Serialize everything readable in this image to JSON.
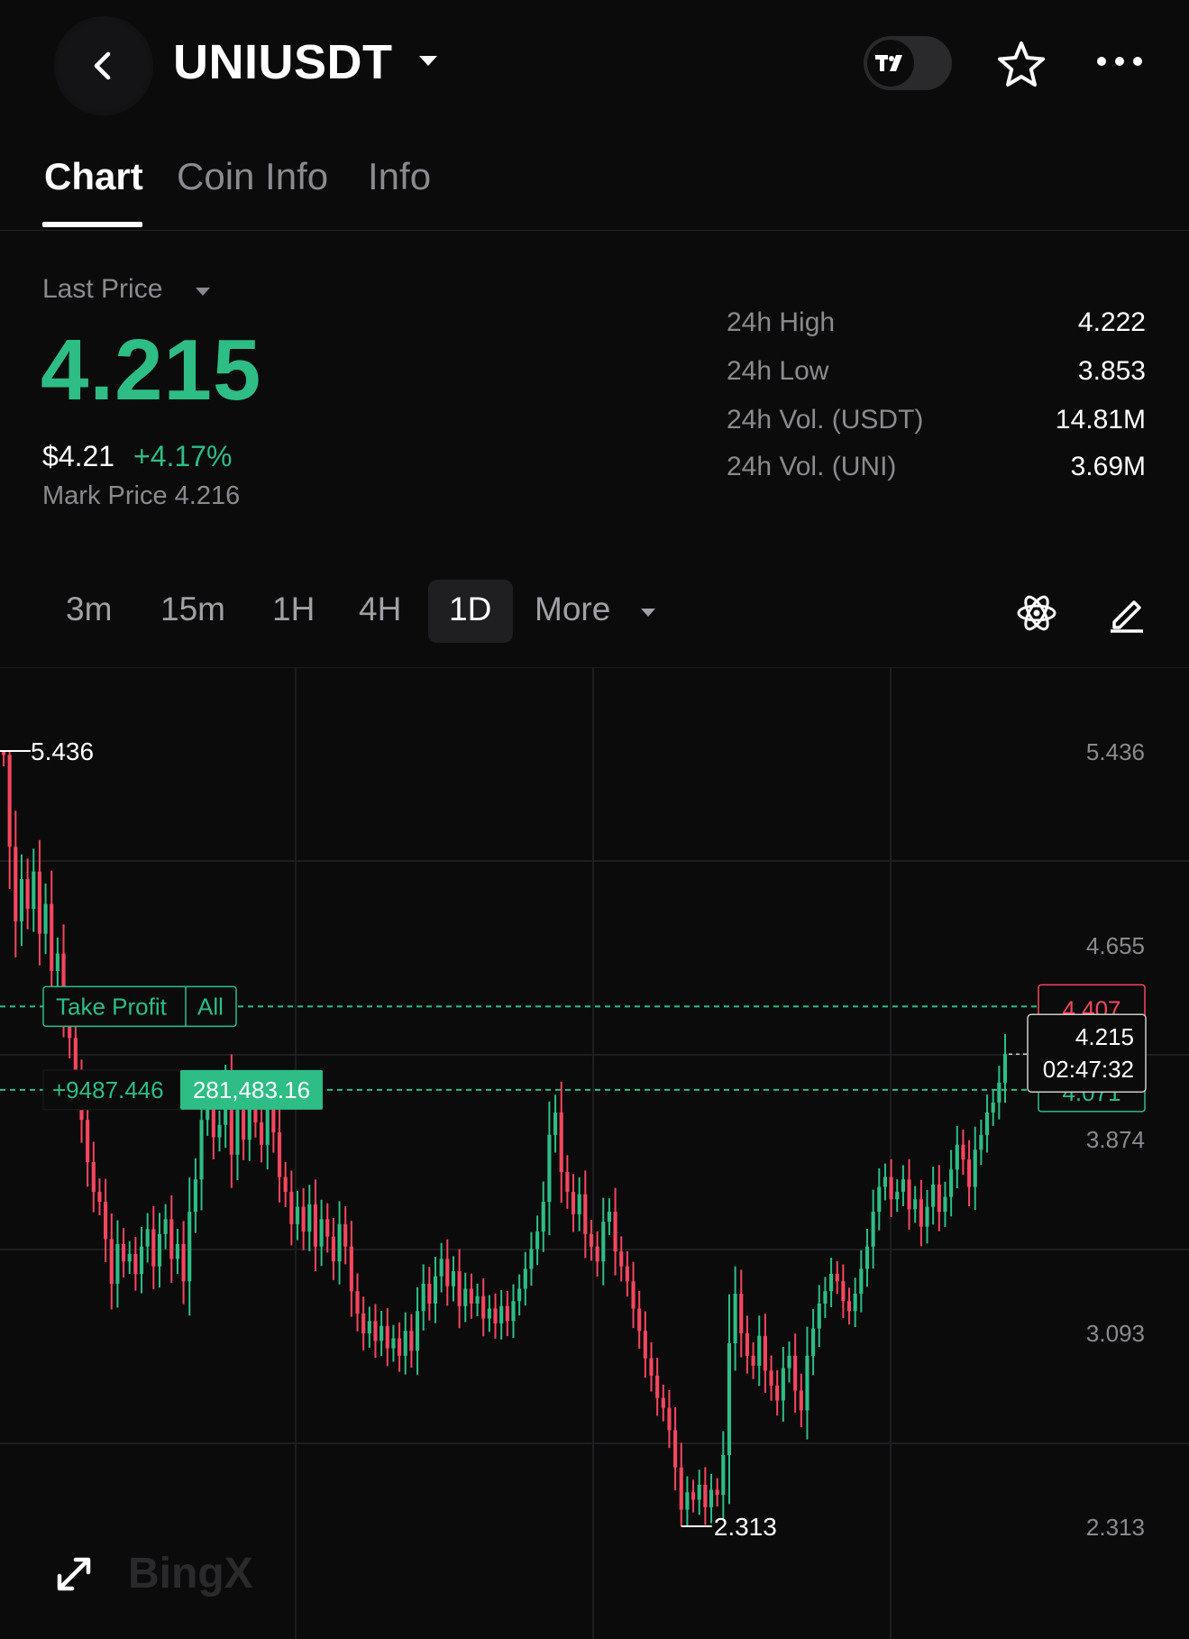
{
  "header": {
    "symbol": "UNIUSDT",
    "toggle_icon": "tradingview-logo-icon"
  },
  "tabs": [
    {
      "label": "Chart",
      "active": true
    },
    {
      "label": "Coin Info",
      "active": false
    },
    {
      "label": "Info",
      "active": false
    }
  ],
  "price": {
    "label": "Last Price",
    "last": "4.215",
    "usd": "$4.21",
    "change": "+4.17%",
    "mark": "Mark Price 4.216",
    "color_up": "#2ebd85"
  },
  "stats": [
    {
      "label": "24h High",
      "value": "4.222"
    },
    {
      "label": "24h Low",
      "value": "3.853"
    },
    {
      "label": "24h Vol. (USDT)",
      "value": "14.81M"
    },
    {
      "label": "24h Vol. (UNI)",
      "value": "3.69M"
    }
  ],
  "intervals": {
    "items": [
      "3m",
      "15m",
      "1H",
      "4H",
      "1D"
    ],
    "selected": "1D",
    "more_label": "More"
  },
  "chart_data": {
    "type": "candlestick",
    "y_ticks": [
      "5.436",
      "4.655",
      "3.874",
      "3.093",
      "2.313"
    ],
    "ylim": [
      2.313,
      5.436
    ],
    "high_marker": "5.436",
    "low_marker": "2.313",
    "take_profit": {
      "label": "Take Profit",
      "scope": "All",
      "price": "4.407"
    },
    "position": {
      "pnl": "+9487.446",
      "size": "281,483.16",
      "price": "4.071"
    },
    "current": {
      "price": "4.215",
      "countdown": "02:47:32"
    },
    "watermark": "BingX",
    "colors": {
      "up": "#2ebd85",
      "down": "#f6465d"
    },
    "closes": [
      5.42,
      5.05,
      4.75,
      4.92,
      4.8,
      4.95,
      4.7,
      4.82,
      4.55,
      4.62,
      4.4,
      4.28,
      4.1,
      3.95,
      3.78,
      3.66,
      3.62,
      3.47,
      3.29,
      3.45,
      3.38,
      3.41,
      3.33,
      3.44,
      3.51,
      3.36,
      3.49,
      3.55,
      3.39,
      3.45,
      3.3,
      3.58,
      3.71,
      3.95,
      4.02,
      3.88,
      3.93,
      4.08,
      3.81,
      3.99,
      3.87,
      4.0,
      3.94,
      3.85,
      4.02,
      3.9,
      3.72,
      3.66,
      3.53,
      3.6,
      3.5,
      3.61,
      3.44,
      3.55,
      3.48,
      3.38,
      3.53,
      3.44,
      3.26,
      3.17,
      3.09,
      3.14,
      3.06,
      3.12,
      3.03,
      3.07,
      3.0,
      3.1,
      3.02,
      3.18,
      3.29,
      3.21,
      3.32,
      3.39,
      3.28,
      3.34,
      3.2,
      3.27,
      3.21,
      3.24,
      3.15,
      3.19,
      3.13,
      3.2,
      3.14,
      3.22,
      3.27,
      3.35,
      3.43,
      3.5,
      3.62,
      3.89,
      3.98,
      3.74,
      3.66,
      3.57,
      3.65,
      3.49,
      3.44,
      3.38,
      3.54,
      3.58,
      3.42,
      3.36,
      3.3,
      3.19,
      3.1,
      2.99,
      2.92,
      2.83,
      2.79,
      2.7,
      2.55,
      2.38,
      2.45,
      2.42,
      2.48,
      2.39,
      2.46,
      2.44,
      2.6,
      3.05,
      3.25,
      3.09,
      3.0,
      2.96,
      3.08,
      2.94,
      2.88,
      2.82,
      2.95,
      3.0,
      2.86,
      2.78,
      3.0,
      3.11,
      3.21,
      3.26,
      3.33,
      3.3,
      3.22,
      3.18,
      3.25,
      3.35,
      3.44,
      3.58,
      3.68,
      3.72,
      3.63,
      3.66,
      3.71,
      3.59,
      3.63,
      3.52,
      3.6,
      3.69,
      3.58,
      3.64,
      3.75,
      3.85,
      3.79,
      3.68,
      3.83,
      3.89,
      3.98,
      4.02,
      4.1,
      4.215
    ]
  }
}
